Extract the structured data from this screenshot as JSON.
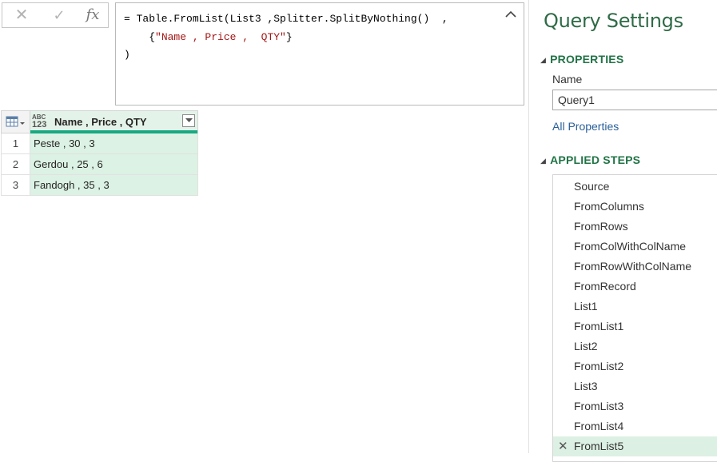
{
  "formula_bar": {
    "cancel_icon": "close-icon",
    "commit_icon": "checkmark-icon",
    "fx_label": "fx",
    "formula_line1_prefix": "= Table.FromList(List3 ,Splitter.SplitByNothing()  ,",
    "formula_line2_prefix": "    {",
    "formula_line2_string": "\"Name , Price ,  QTY\"",
    "formula_line2_suffix": "}",
    "formula_line3": ")",
    "collapse_icon": "chevron-up-icon"
  },
  "table": {
    "corner_icon": "table-icon",
    "column": {
      "type_icon_top": "ABC",
      "type_icon_bottom": "123",
      "name": "Name , Price , QTY",
      "filter_icon": "chevron-down-icon"
    },
    "rows": [
      {
        "num": "1",
        "value": "Peste , 30 , 3"
      },
      {
        "num": "2",
        "value": "Gerdou , 25 , 6"
      },
      {
        "num": "3",
        "value": "Fandogh , 35 , 3"
      }
    ]
  },
  "query_settings": {
    "title": "Query Settings",
    "properties_heading": "PROPERTIES",
    "name_label": "Name",
    "name_value": "Query1",
    "all_properties_link": "All Properties",
    "applied_steps_heading": "APPLIED STEPS",
    "steps": [
      "Source",
      "FromColumns",
      "FromRows",
      "FromColWithColName",
      "FromRowWithColName",
      "FromRecord",
      "List1",
      "FromList1",
      "List2",
      "FromList2",
      "List3",
      "FromList3",
      "FromList4",
      "FromList5"
    ],
    "selected_step": "FromList5",
    "delete_step_icon": "close-icon"
  }
}
